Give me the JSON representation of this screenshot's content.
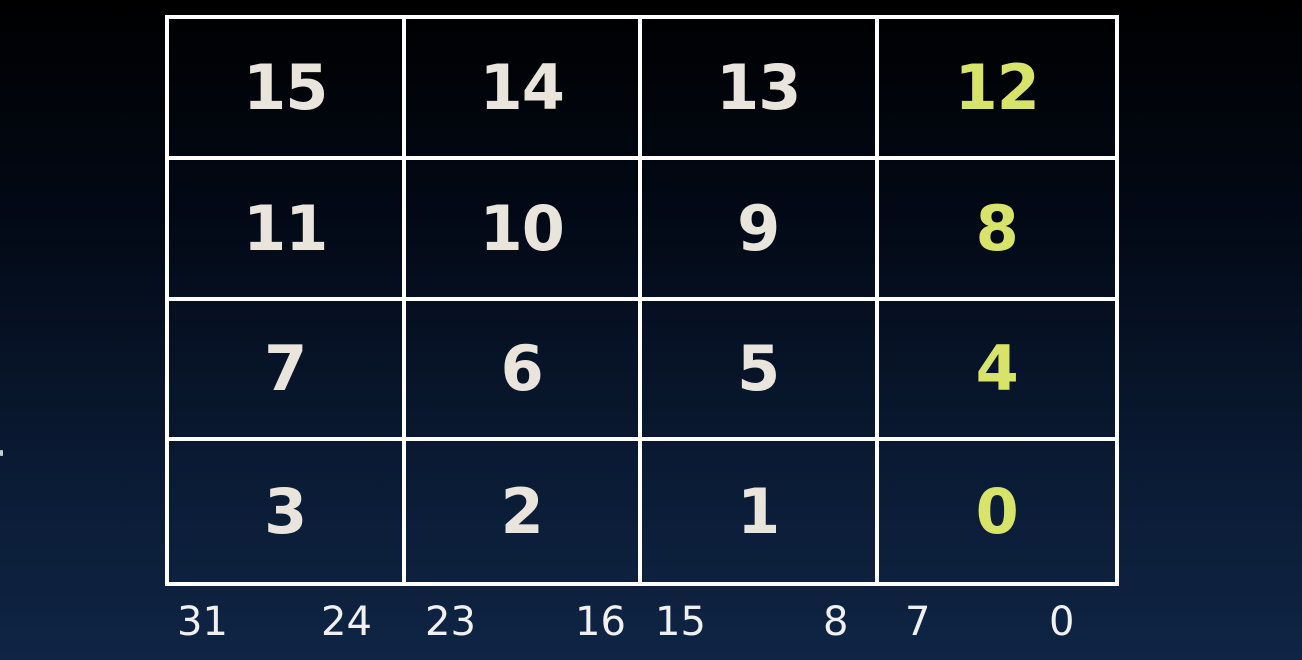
{
  "grid": {
    "rows": [
      [
        "15",
        "14",
        "13",
        "12"
      ],
      [
        "11",
        "10",
        "9",
        "8"
      ],
      [
        "7",
        "6",
        "5",
        "4"
      ],
      [
        "3",
        "2",
        "1",
        "0"
      ]
    ],
    "highlight_color": "#d8e36a",
    "text_color": "#e9e4dc",
    "line_color": "#ffffff"
  },
  "bit_labels": [
    "31",
    "24",
    "23",
    "16",
    "15",
    "8",
    "7",
    "0"
  ]
}
